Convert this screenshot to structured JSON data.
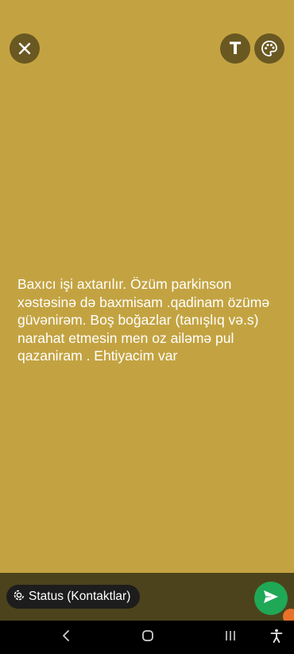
{
  "status_editor": {
    "text": "Baxıcı işi axtarılır.  Özüm parkinson xəstəsinə də baxmisam .qadinam özümə güvənirəm. Boş boğazlar (tanışlıq və.s) narahat etmesin men oz ailəmə pul qazaniram . Ehtiyacim var",
    "background_color": "#c3a341",
    "top_controls": {
      "close_icon": "close-icon",
      "text_tool_label": "T",
      "palette_icon": "palette-icon"
    },
    "bottom_bar": {
      "audience_label": "Status (Kontaktlar)",
      "audience_icon": "status-icon",
      "send_icon": "send-icon",
      "send_color": "#1fa855"
    }
  },
  "system_nav": {
    "items": [
      "back-icon",
      "home-icon",
      "recents-icon",
      "accessibility-icon"
    ]
  }
}
